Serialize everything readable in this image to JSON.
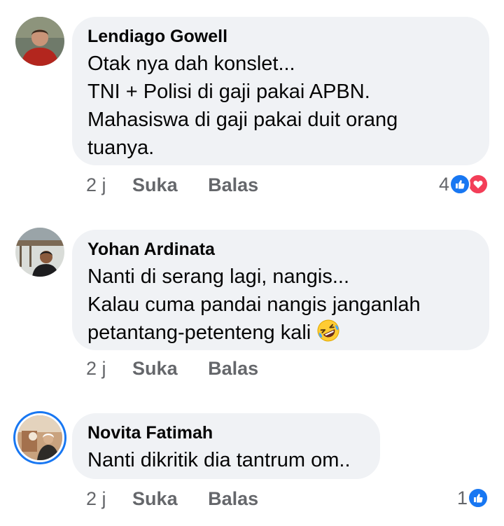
{
  "comments": [
    {
      "author": "Lendiago Gowell",
      "lines": [
        "Otak nya dah konslet...",
        "TNI + Polisi di gaji pakai APBN.",
        "Mahasiswa di gaji pakai duit orang",
        "tuanya."
      ],
      "time": "2 j",
      "like_label": "Suka",
      "reply_label": "Balas",
      "reaction_count": "4",
      "reactions": [
        "like-icon",
        "love-icon"
      ]
    },
    {
      "author": "Yohan Ardinata",
      "lines": [
        "Nanti di serang lagi, nangis...",
        "Kalau cuma pandai nangis janganlah",
        "petantang-petenteng kali"
      ],
      "emoji": "rolling-on-floor-laughing-emoji",
      "time": "2 j",
      "like_label": "Suka",
      "reply_label": "Balas"
    },
    {
      "author": "Novita Fatimah",
      "lines": [
        "Nanti dikritik dia tantrum om.."
      ],
      "time": "2 j",
      "like_label": "Suka",
      "reply_label": "Balas",
      "reaction_count": "1",
      "reactions": [
        "like-icon"
      ]
    }
  ],
  "colors": {
    "bubble": "#f0f2f5",
    "meta_text": "#65676b",
    "like_blue": "#1877f2",
    "love_red": "#f33e58"
  }
}
